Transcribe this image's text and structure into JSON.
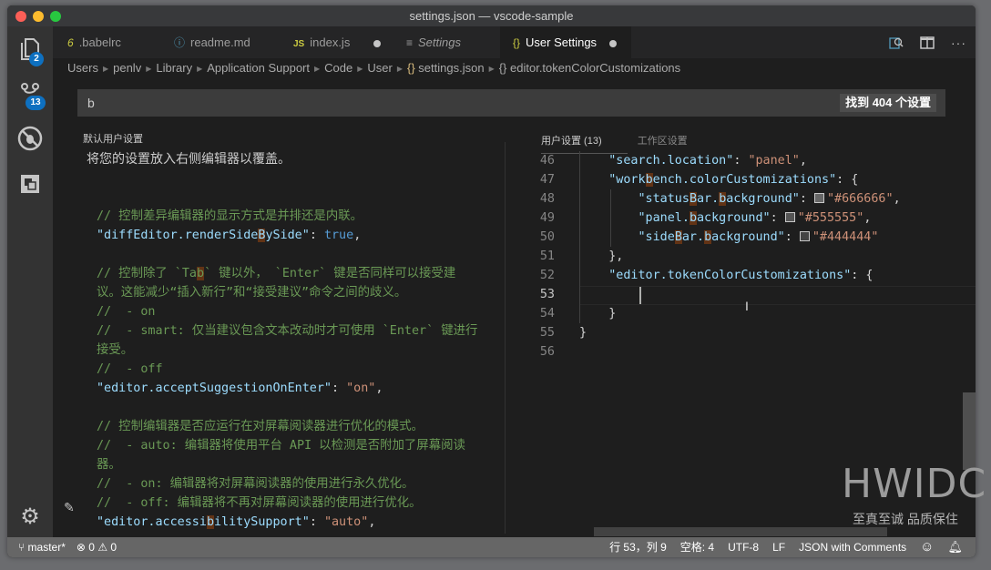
{
  "window": {
    "title": "settings.json — vscode-sample"
  },
  "activity_bar": {
    "items": [
      {
        "name": "explorer",
        "icon": "files-icon",
        "badge": "2"
      },
      {
        "name": "source-control",
        "icon": "source-control-icon",
        "badge": "13"
      },
      {
        "name": "debug",
        "icon": "debug-icon",
        "badge": null
      },
      {
        "name": "extensions",
        "icon": "extensions-icon",
        "badge": null
      }
    ],
    "settings_icon": "gear-icon"
  },
  "tabs": [
    {
      "label": ".babelrc",
      "icon": "6",
      "icon_color": "#cbcb41",
      "active": false,
      "dirty": false,
      "italic": false
    },
    {
      "label": "readme.md",
      "icon": "ⓘ",
      "icon_color": "#519aba",
      "active": false,
      "dirty": false,
      "italic": false
    },
    {
      "label": "index.js",
      "icon": "JS",
      "icon_color": "#cbcb41",
      "active": false,
      "dirty": true,
      "italic": false
    },
    {
      "label": "Settings",
      "icon": "≡",
      "icon_color": "#9d9d9d",
      "active": false,
      "dirty": false,
      "italic": true
    },
    {
      "label": "User Settings",
      "icon": "{}",
      "icon_color": "#cbcb41",
      "active": true,
      "dirty": true,
      "italic": false
    }
  ],
  "tab_actions": [
    "open-settings-icon",
    "split-editor-icon",
    "more-actions-icon"
  ],
  "breadcrumb": [
    "Users",
    "penlv",
    "Library",
    "Application Support",
    "Code",
    "User",
    "settings.json",
    "editor.tokenColorCustomizations"
  ],
  "search": {
    "value": "b",
    "result_count": "找到 404 个设置"
  },
  "left_pane": {
    "header": "默认用户设置",
    "hint": "将您的设置放入右侧编辑器以覆盖。",
    "lines": [
      [],
      [
        {
          "t": "cm",
          "v": "// 控制差异编辑器的显示方式是并排还是内联。"
        }
      ],
      [
        {
          "t": "key",
          "v": "\"diffEditor.renderSide"
        },
        {
          "t": "key hl",
          "v": "B"
        },
        {
          "t": "key",
          "v": "ySide\""
        },
        {
          "t": "pun",
          "v": ": "
        },
        {
          "t": "kw",
          "v": "true"
        },
        {
          "t": "pun",
          "v": ","
        }
      ],
      [],
      [
        {
          "t": "cm",
          "v": "// 控制除了 `Ta"
        },
        {
          "t": "cm hl",
          "v": "b"
        },
        {
          "t": "cm",
          "v": "` 键以外， `Enter` 键是否同样可以接受建"
        }
      ],
      [
        {
          "t": "cm",
          "v": "议。这能减少“插入新行”和“接受建议”命令之间的歧义。"
        }
      ],
      [
        {
          "t": "cm",
          "v": "//  - on"
        }
      ],
      [
        {
          "t": "cm",
          "v": "//  - smart: 仅当建议包含文本改动时才可使用 `Enter` 键进行"
        }
      ],
      [
        {
          "t": "cm",
          "v": "接受。"
        }
      ],
      [
        {
          "t": "cm",
          "v": "//  - off"
        }
      ],
      [
        {
          "t": "key",
          "v": "\"editor.acceptSuggestionOnEnter\""
        },
        {
          "t": "pun",
          "v": ": "
        },
        {
          "t": "str",
          "v": "\"on\""
        },
        {
          "t": "pun",
          "v": ","
        }
      ],
      [],
      [
        {
          "t": "cm",
          "v": "// 控制编辑器是否应运行在对屏幕阅读器进行优化的模式。"
        }
      ],
      [
        {
          "t": "cm",
          "v": "//  - auto: 编辑器将使用平台 API 以检测是否附加了屏幕阅读"
        }
      ],
      [
        {
          "t": "cm",
          "v": "器。"
        }
      ],
      [
        {
          "t": "cm",
          "v": "//  - on: 编辑器将对屏幕阅读器的使用进行永久优化。"
        }
      ],
      [
        {
          "t": "cm",
          "v": "//  - off: 编辑器将不再对屏幕阅读器的使用进行优化。"
        }
      ],
      [
        {
          "t": "key",
          "v": "\"editor.accessi"
        },
        {
          "t": "key hl",
          "v": "b"
        },
        {
          "t": "key",
          "v": "ilitySupport\""
        },
        {
          "t": "pun",
          "v": ": "
        },
        {
          "t": "str",
          "v": "\"auto\""
        },
        {
          "t": "pun",
          "v": ","
        }
      ]
    ]
  },
  "right_pane": {
    "tabs": [
      {
        "label": "用户设置 (13)",
        "active": true
      },
      {
        "label": "工作区设置",
        "active": false
      }
    ],
    "line_numbers": [
      "46",
      "47",
      "48",
      "49",
      "50",
      "51",
      "52",
      "53",
      "54",
      "55",
      "56"
    ],
    "current_line": "53",
    "lines": [
      [
        {
          "t": "key",
          "v": "    \"search.location\""
        },
        {
          "t": "pun",
          "v": ": "
        },
        {
          "t": "str",
          "v": "\"panel\""
        },
        {
          "t": "pun",
          "v": ","
        }
      ],
      [
        {
          "t": "key",
          "v": "    \"work"
        },
        {
          "t": "key hl",
          "v": "b"
        },
        {
          "t": "key",
          "v": "ench.colorCustomizations\""
        },
        {
          "t": "pun",
          "v": ": {"
        }
      ],
      [
        {
          "t": "key",
          "v": "        \"status"
        },
        {
          "t": "key hl",
          "v": "B"
        },
        {
          "t": "key",
          "v": "ar."
        },
        {
          "t": "key hl",
          "v": "b"
        },
        {
          "t": "key",
          "v": "ackground\""
        },
        {
          "t": "pun",
          "v": ": "
        },
        {
          "t": "swatch",
          "v": "#666666"
        },
        {
          "t": "str",
          "v": "\"#666666\""
        },
        {
          "t": "pun",
          "v": ","
        }
      ],
      [
        {
          "t": "key",
          "v": "        \"panel."
        },
        {
          "t": "key hl",
          "v": "b"
        },
        {
          "t": "key",
          "v": "ackground\""
        },
        {
          "t": "pun",
          "v": ": "
        },
        {
          "t": "swatch",
          "v": "#555555"
        },
        {
          "t": "str",
          "v": "\"#555555\""
        },
        {
          "t": "pun",
          "v": ","
        }
      ],
      [
        {
          "t": "key",
          "v": "        \"side"
        },
        {
          "t": "key hl",
          "v": "B"
        },
        {
          "t": "key",
          "v": "ar."
        },
        {
          "t": "key hl",
          "v": "b"
        },
        {
          "t": "key",
          "v": "ackground\""
        },
        {
          "t": "pun",
          "v": ": "
        },
        {
          "t": "swatch",
          "v": "#444444"
        },
        {
          "t": "str",
          "v": "\"#444444\""
        }
      ],
      [
        {
          "t": "pun",
          "v": "    },"
        }
      ],
      [
        {
          "t": "key",
          "v": "    \"editor.tokenColorCustomizations\""
        },
        {
          "t": "pun",
          "v": ": {"
        }
      ],
      [
        {
          "t": "pun",
          "v": ""
        }
      ],
      [
        {
          "t": "pun",
          "v": "    }"
        }
      ],
      [
        {
          "t": "pun",
          "v": "}"
        }
      ],
      []
    ]
  },
  "status_bar": {
    "branch": "master*",
    "errors": "0",
    "warnings": "0",
    "position": "行 53，列 9",
    "indent": "空格: 4",
    "encoding": "UTF-8",
    "eol": "LF",
    "language": "JSON with Comments"
  },
  "watermark": {
    "brand": "HWIDC",
    "slogan": "至真至诚 品质保住"
  }
}
